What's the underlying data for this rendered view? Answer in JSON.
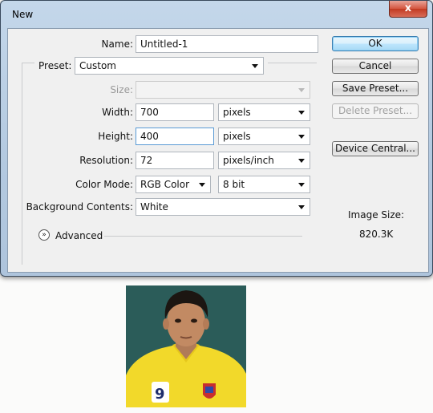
{
  "window": {
    "title": "New",
    "close_glyph": "x"
  },
  "fields": {
    "name_label": "Name:",
    "name_value": "Untitled-1",
    "preset_label": "Preset:",
    "preset_value": "Custom",
    "size_label": "Size:",
    "size_value": "",
    "width_label": "Width:",
    "width_value": "700",
    "width_unit": "pixels",
    "height_label": "Height:",
    "height_value": "400",
    "height_unit": "pixels",
    "resolution_label": "Resolution:",
    "resolution_value": "72",
    "resolution_unit": "pixels/inch",
    "color_mode_label": "Color Mode:",
    "color_mode_value": "RGB Color",
    "bit_depth_value": "8 bit",
    "background_label": "Background Contents:",
    "background_value": "White",
    "advanced_label": "Advanced"
  },
  "buttons": {
    "ok": "OK",
    "cancel": "Cancel",
    "save_preset": "Save Preset...",
    "delete_preset": "Delete Preset...",
    "device_central": "Device Central..."
  },
  "info": {
    "image_size_label": "Image Size:",
    "image_size_value": "820.3K"
  },
  "icons": {
    "close": "close-icon",
    "advanced": "chevron-double-down-icon",
    "dropdown": "chevron-down-icon"
  },
  "colors": {
    "title_bar": "#b9cde3",
    "close_button": "#c94a33",
    "photo_background": "#2b5c59",
    "shirt": "#f2d92a"
  }
}
